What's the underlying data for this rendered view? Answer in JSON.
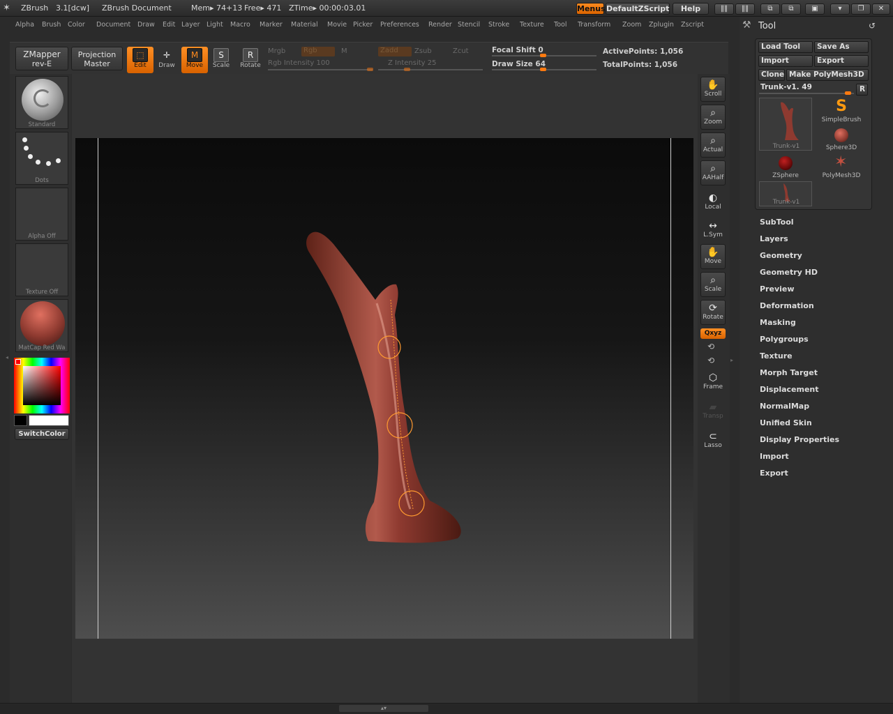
{
  "app": {
    "name": "ZBrush",
    "version": "3.1[dcw]",
    "doc": "ZBrush Document",
    "mem": "Mem▸ 74+13",
    "free": "Free▸ 471",
    "ztime": "ZTime▸ 00:00:03.01"
  },
  "title_buttons": {
    "menus": "Menus",
    "script": "DefaultZScript",
    "help": "Help"
  },
  "menu": [
    "Alpha",
    "Brush",
    "Color",
    "Document",
    "Draw",
    "Edit",
    "Layer",
    "Light",
    "Macro",
    "Marker",
    "Material",
    "Movie",
    "Picker",
    "Preferences",
    "Render",
    "Stencil",
    "Stroke",
    "Texture",
    "Tool",
    "Transform",
    "Zoom",
    "Zplugin",
    "Zscript"
  ],
  "shelf": {
    "zmapper": "ZMapper",
    "zmapper_sub": "rev-E",
    "projection": "Projection",
    "projection_sub": "Master",
    "edit": "Edit",
    "draw": "Draw",
    "move": "Move",
    "scale": "Scale",
    "rotate": "Rotate",
    "mrgb": "Mrgb",
    "rgb": "Rgb",
    "m": "M",
    "zadd": "Zadd",
    "zsub": "Zsub",
    "zcut": "Zcut",
    "rgb_intensity": "Rgb Intensity 100",
    "z_intensity": "Z Intensity 25",
    "focal_shift": "Focal Shift 0",
    "draw_size": "Draw Size 64",
    "active_points": "ActivePoints: 1,056",
    "total_points": "TotalPoints: 1,056"
  },
  "left": {
    "brush": "Standard",
    "stroke": "Dots",
    "alpha": "Alpha  Off",
    "texture": "Texture  Off",
    "material": "MatCap Red Wa",
    "switch_color": "SwitchColor"
  },
  "right": {
    "scroll": "Scroll",
    "zoom": "Zoom",
    "actual": "Actual",
    "aahalf": "AAHalf",
    "local": "Local",
    "lsym": "L.Sym",
    "move": "Move",
    "scale": "Scale",
    "rotate": "Rotate",
    "xyz": "Qxyz",
    "frame": "Frame",
    "transp": "Transp",
    "lasso": "Lasso"
  },
  "tool_panel": {
    "title": "Tool",
    "load_tool": "Load Tool",
    "save_as": "Save As",
    "import": "Import",
    "export": "Export",
    "clone": "Clone",
    "make_polymesh": "Make PolyMesh3D",
    "current_tool": "Trunk-v1. 49",
    "r_button": "R",
    "thumbs": [
      "Trunk-v1",
      "SimpleBrush",
      "Sphere3D",
      "ZSphere",
      "PolyMesh3D",
      "Trunk-v1"
    ],
    "subpalettes": [
      "SubTool",
      "Layers",
      "Geometry",
      "Geometry HD",
      "Preview",
      "Deformation",
      "Masking",
      "Polygroups",
      "Texture",
      "Morph Target",
      "Displacement",
      "NormalMap",
      "Unified Skin",
      "Display Properties",
      "Import",
      "Export"
    ]
  },
  "colors": {
    "accent": "#ff8a1e",
    "model": "#8e3a30"
  },
  "sliders": {
    "focal_shift": 0,
    "draw_size": 64,
    "rgb_intensity": 100,
    "z_intensity": 25
  },
  "icons": {
    "app_logo": "zbrush-logo-icon",
    "tool_panel": "hammer-icon",
    "reset": "undo-icon"
  }
}
